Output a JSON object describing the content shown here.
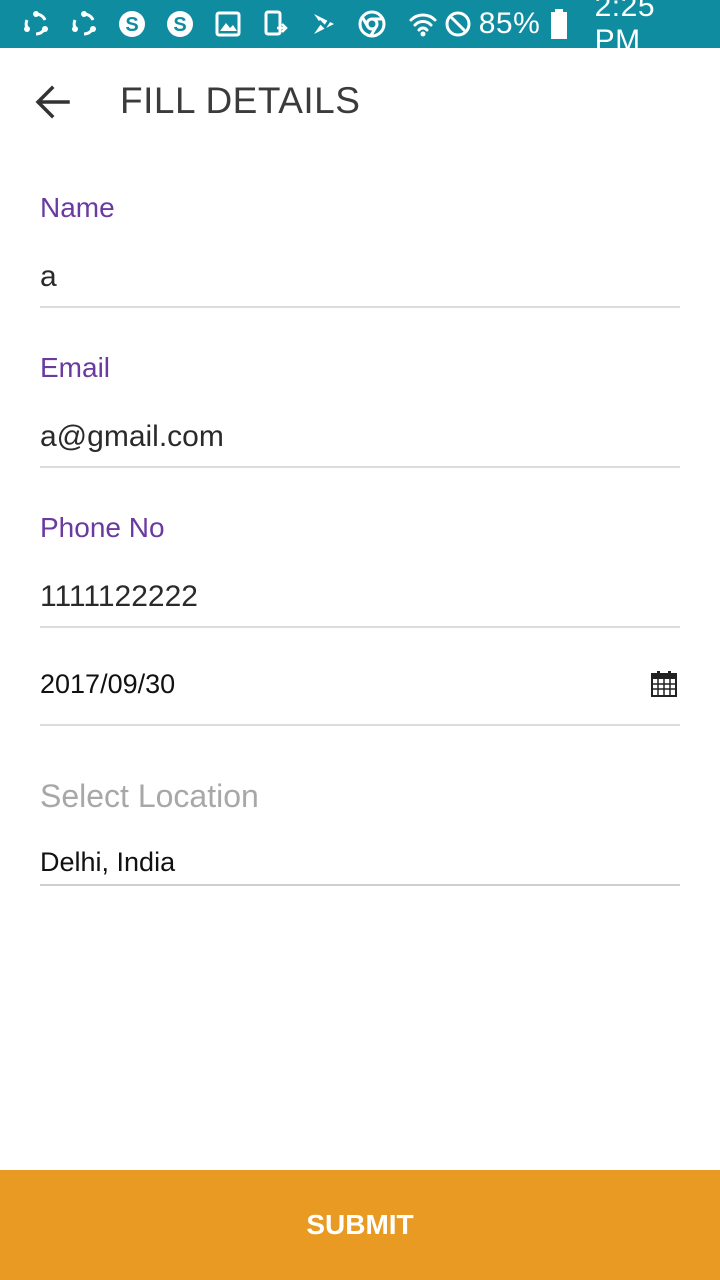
{
  "status_bar": {
    "notification_icons": [
      "sync-icon",
      "sync-icon",
      "skype-icon",
      "skype-icon",
      "gallery-icon",
      "device-transfer-icon",
      "app-icon",
      "chrome-icon"
    ],
    "wifi_icon": "wifi-icon",
    "dnd_icon": "do-not-disturb-icon",
    "battery_percent": "85%",
    "battery_icon": "battery-icon",
    "time": "2:25 PM",
    "background_color": "#0f8ca0"
  },
  "header": {
    "back_icon": "arrow-back-icon",
    "title": "FILL DETAILS"
  },
  "form": {
    "name": {
      "label": "Name",
      "value": "a"
    },
    "email": {
      "label": "Email",
      "value": "a@gmail.com"
    },
    "phone": {
      "label": "Phone No",
      "value": "1111122222"
    },
    "date": {
      "value": "2017/09/30",
      "icon": "calendar-icon"
    },
    "location": {
      "label": "Select Location",
      "value": "Delhi, India"
    },
    "label_color": "#6a3aa0"
  },
  "submit": {
    "label": "SUBMIT",
    "color": "#e99a22"
  }
}
